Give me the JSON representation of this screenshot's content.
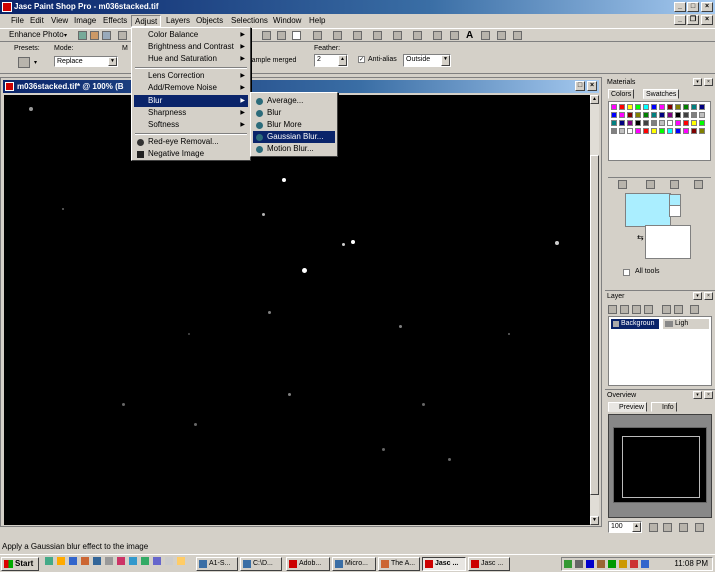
{
  "app": {
    "title": "Jasc Paint Shop Pro - m036stacked.tif"
  },
  "menubar": {
    "items": [
      "File",
      "Edit",
      "View",
      "Image",
      "Effects",
      "Adjust",
      "Layers",
      "Objects",
      "Selections",
      "Window",
      "Help"
    ],
    "active": "Adjust"
  },
  "toolbar": {
    "enhance_photo": "Enhance Photo"
  },
  "options": {
    "presets_label": "Presets:",
    "mode_label": "Mode:",
    "mode_value": "Replace",
    "match_label": "M",
    "sample_merged": "Sample merged",
    "feather_label": "Feather:",
    "feather_value": "2",
    "antialias_label": "Anti-alias",
    "antialias_mode": "Outside"
  },
  "document": {
    "title": "m036stacked.tif* @ 100% (B"
  },
  "adjust_menu": {
    "items": [
      "Color Balance",
      "Brightness and Contrast",
      "Hue and Saturation",
      "Lens Correction",
      "Add/Remove Noise",
      "Blur",
      "Sharpness",
      "Softness",
      "Red-eye Removal...",
      "Negative Image"
    ],
    "selected": "Blur"
  },
  "blur_submenu": {
    "items": [
      "Average...",
      "Blur",
      "Blur More",
      "Gaussian Blur...",
      "Motion Blur..."
    ],
    "selected": "Gaussian Blur..."
  },
  "materials": {
    "title": "Materials",
    "tabs": [
      "Colors",
      "Swatches"
    ],
    "all_tools": "All tools",
    "fg_color": "#aaeeff",
    "bg_color": "#ffffff"
  },
  "layer_panel": {
    "title": "Layer",
    "layer_name": "Backgroun",
    "layer_info": "Ligh"
  },
  "overview": {
    "title": "Overview",
    "tabs": [
      "Preview",
      "Info"
    ],
    "zoom": "100"
  },
  "statusbar": {
    "text": "Apply a Gaussian blur effect to the image"
  },
  "taskbar": {
    "start": "Start",
    "tasks": [
      "A1-S...",
      "C:\\D...",
      "Adob...",
      "Micro...",
      "The A...",
      "Jasc ...",
      "Jasc ..."
    ],
    "active_task": 5,
    "clock": "11:08 PM"
  }
}
